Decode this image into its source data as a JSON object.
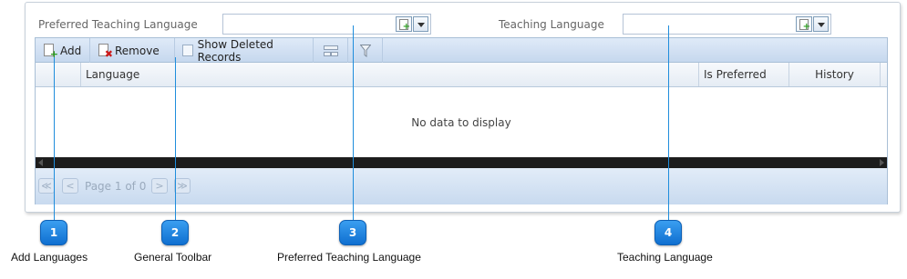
{
  "form": {
    "preferred_label": "Preferred Teaching Language",
    "teaching_label": "Teaching Language",
    "preferred_value": "",
    "teaching_value": ""
  },
  "toolbar": {
    "add_label": "Add",
    "remove_label": "Remove",
    "show_deleted_label": "Show Deleted Records",
    "show_deleted_checked": false
  },
  "grid": {
    "columns": [
      "Language",
      "Is Preferred",
      "History"
    ],
    "empty_text": "No data to display"
  },
  "pager": {
    "first_glyph": "≪",
    "prev_glyph": "<",
    "page_text": "Page 1 of 0",
    "next_glyph": ">",
    "last_glyph": "≫"
  },
  "callouts": [
    {
      "number": "1",
      "caption": "Add Languages"
    },
    {
      "number": "2",
      "caption": "General Toolbar"
    },
    {
      "number": "3",
      "caption": "Preferred Teaching Language"
    },
    {
      "number": "4",
      "caption": "Teaching Language"
    }
  ],
  "colors": {
    "accent": "#1f8ddc",
    "toolbar": "#c6d8ee",
    "badge": "#1f7fe0"
  }
}
